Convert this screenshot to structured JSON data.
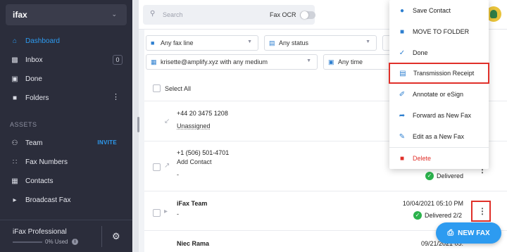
{
  "brand": {
    "logo": "ifax"
  },
  "sidebar": {
    "items": [
      {
        "label": "Dashboard",
        "icon": "home-icon"
      },
      {
        "label": "Inbox",
        "icon": "inbox-icon",
        "badge": "0"
      },
      {
        "label": "Done",
        "icon": "done-folder-icon"
      },
      {
        "label": "Folders",
        "icon": "folder-icon"
      }
    ],
    "assets_heading": "ASSETS",
    "assets": [
      {
        "label": "Team",
        "icon": "team-icon",
        "action": "INVITE"
      },
      {
        "label": "Fax Numbers",
        "icon": "dialpad-icon"
      },
      {
        "label": "Contacts",
        "icon": "contacts-icon"
      },
      {
        "label": "Broadcast Fax",
        "icon": "megaphone-icon"
      }
    ],
    "plan": {
      "name": "iFax Professional",
      "usage": "0% Used",
      "usage_fraction": 0
    }
  },
  "topbar": {
    "search_placeholder": "Search",
    "fax_ocr_label": "Fax OCR",
    "fax_ocr_enabled": false
  },
  "filters": {
    "fax_line": "Any fax line",
    "status": "Any status",
    "account": "krisette@amplify.xyz with any medium",
    "time": "Any time"
  },
  "list": {
    "select_all": "Select All",
    "rows": [
      {
        "line1": "+44 20 3475 1208",
        "line2": "Unassigned",
        "date": "",
        "status": ""
      },
      {
        "line1": "+1 (506) 501-4701",
        "line2": "Add Contact",
        "line3": "-",
        "date": "",
        "status": "Delivered"
      },
      {
        "line1": "iFax Team",
        "line2": "-",
        "date": "10/04/2021 05:10 PM",
        "status": "Delivered 2/2"
      },
      {
        "line1": "Niec Rama",
        "line2": "",
        "date": "09/21/2021 05:",
        "status": ""
      }
    ]
  },
  "menu": {
    "items": [
      {
        "label": "Save Contact",
        "icon": "add-contact-icon"
      },
      {
        "label": "MOVE TO FOLDER",
        "icon": "move-folder-icon"
      },
      {
        "label": "Done",
        "icon": "check-icon"
      },
      {
        "label": "Transmission Receipt",
        "icon": "receipt-icon"
      },
      {
        "label": "Annotate or eSign",
        "icon": "sign-icon"
      },
      {
        "label": "Forward as New Fax",
        "icon": "forward-icon"
      },
      {
        "label": "Edit as a New Fax",
        "icon": "edit-icon"
      },
      {
        "label": "Delete",
        "icon": "trash-icon"
      }
    ]
  },
  "fab": {
    "label": "NEW FAX"
  },
  "colors": {
    "accent": "#2d9bf0",
    "sidebar": "#2b2d3b",
    "danger": "#e0302a",
    "success": "#2bb24c"
  }
}
